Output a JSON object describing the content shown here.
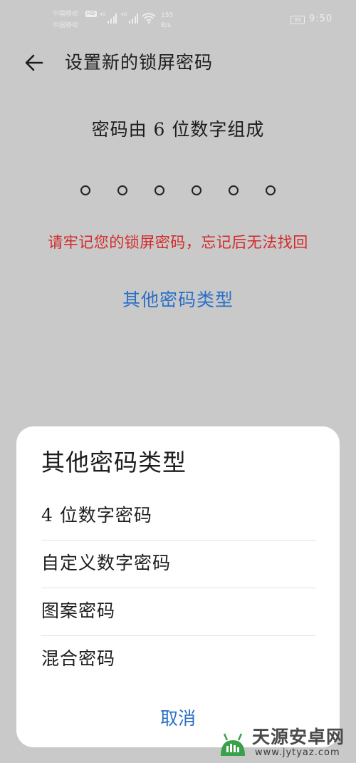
{
  "status_bar": {
    "carrier_1": "中国移动",
    "carrier_2": "中国移动",
    "hd_badge": "HD",
    "signal_1_type": "4G",
    "signal_2_type": "4G",
    "net_speed_value": "155",
    "net_speed_unit": "B/s",
    "battery_level": "93",
    "time": "9:50",
    "icons": [
      "hd-badge",
      "signal-icon",
      "signal-icon",
      "wifi-icon",
      "battery-icon"
    ]
  },
  "header": {
    "back_icon": "arrow-left-icon",
    "title": "设置新的锁屏密码"
  },
  "pin_entry": {
    "hint": "密码由 6 位数字组成",
    "digit_count": 6,
    "digits_entered": 0,
    "warning": "请牢记您的锁屏密码，忘记后无法找回",
    "warning_color": "#d42a2a",
    "other_link": "其他密码类型",
    "link_color": "#2a6fc7"
  },
  "sheet": {
    "title": "其他密码类型",
    "options": [
      {
        "label": "4 位数字密码"
      },
      {
        "label": "自定义数字密码"
      },
      {
        "label": "图案密码"
      },
      {
        "label": "混合密码"
      }
    ],
    "cancel_label": "取消"
  },
  "watermark": {
    "name": "天源安卓网",
    "url": "www.jytyaz.com"
  },
  "colors": {
    "dim_background": "#c9c9c9",
    "sheet_background": "#ffffff",
    "accent_blue": "#2a6fc7",
    "warning_red": "#d42a2a"
  }
}
